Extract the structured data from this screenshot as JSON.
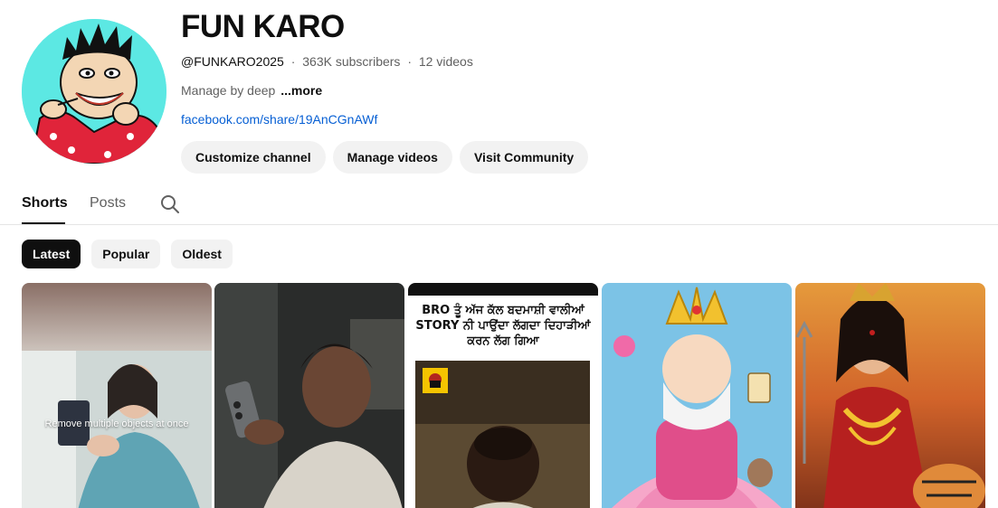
{
  "channel": {
    "name": "FUN KARO",
    "handle": "@FUNKARO2025",
    "subscribers": "363K subscribers",
    "videos": "12 videos",
    "separator": "·",
    "description": "Manage by deep",
    "more_label": "...more",
    "link": "facebook.com/share/19AnCGnAWf"
  },
  "actions": {
    "customize": "Customize channel",
    "manage": "Manage videos",
    "community": "Visit Community"
  },
  "tabs": {
    "shorts": "Shorts",
    "posts": "Posts"
  },
  "filters": {
    "latest": "Latest",
    "popular": "Popular",
    "oldest": "Oldest"
  },
  "shorts": [
    {
      "overlay": "Remove multiple objects at once"
    },
    {
      "overlay": ""
    },
    {
      "caption": "BRO ਤੂੰ ਅੱਜ ਕੱਲ ਬਦਮਾਸ਼ੀ ਵਾਲੀਆਂ STORY  ਨੀ ਪਾਉਂਦਾ ਲੱਗਦਾ ਦਿਹਾੜੀਆਂ ਕਰਨ ਲੱਗ ਗਿਆ"
    },
    {
      "overlay": ""
    },
    {
      "overlay": ""
    }
  ],
  "colors": {
    "accent_link": "#065fd4",
    "chip_active": "#0f0f0f",
    "chip_bg": "#f2f2f2",
    "avatar_bg": "#5ce8e3"
  }
}
